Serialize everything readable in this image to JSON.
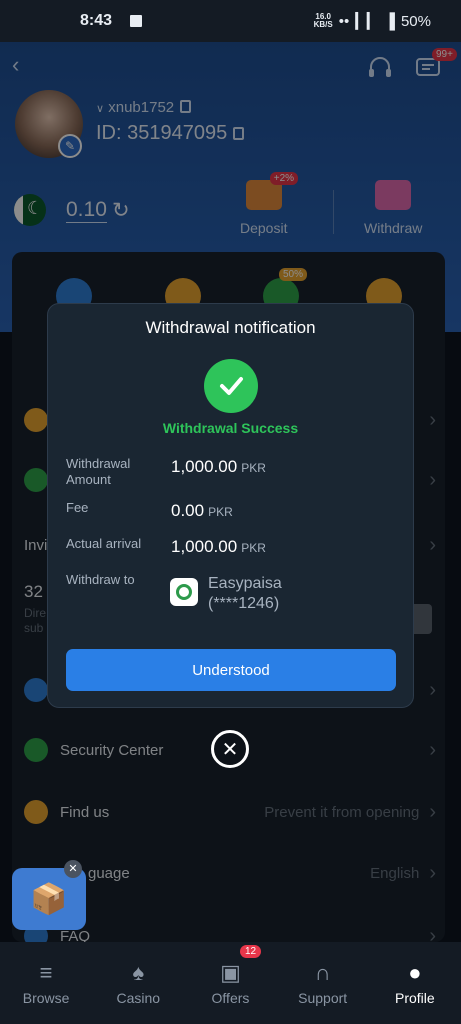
{
  "status_bar": {
    "time": "8:43",
    "speed_top": "16.0",
    "speed_unit": "KB/S",
    "battery": "50%"
  },
  "profile": {
    "username": "xnub1752",
    "id_text": "ID: 351947095",
    "balance": "0.10"
  },
  "header_badge": "99+",
  "actions": {
    "deposit_label": "Deposit",
    "deposit_badge": "+2%",
    "withdraw_label": "Withdraw"
  },
  "panel_badge": "50%",
  "menu": {
    "invite_label": "Invi",
    "partial_number": "32",
    "partial_text1": "Dire",
    "partial_text2": "sub",
    "security": "Security Center",
    "find_us": "Find us",
    "find_us_value": "Prevent it from opening",
    "language": "guage",
    "language_value": "English",
    "faq": "FAQ"
  },
  "modal": {
    "title": "Withdrawal notification",
    "success": "Withdrawal Success",
    "amount_label": "Withdrawal Amount",
    "amount_value": "1,000.00",
    "fee_label": "Fee",
    "fee_value": "0.00",
    "arrival_label": "Actual arrival",
    "arrival_value": "1,000.00",
    "currency": "PKR",
    "withdraw_to_label": "Withdraw to",
    "method_name": "Easypaisa",
    "method_account": "(****1246)",
    "button": "Understood"
  },
  "nav": {
    "browse": "Browse",
    "casino": "Casino",
    "offers": "Offers",
    "offers_badge": "12",
    "support": "Support",
    "profile": "Profile"
  },
  "colors": {
    "header_blue": "#2a63b5",
    "success_green": "#2ec45a",
    "button_blue": "#2a7fe6",
    "badge_red": "#e7364a"
  }
}
